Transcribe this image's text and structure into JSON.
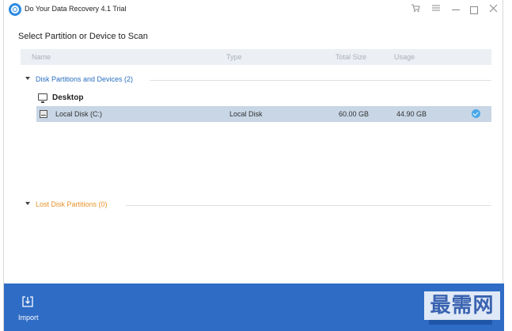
{
  "window": {
    "title": "Do Your Data Recovery 4.1 Trial"
  },
  "main": {
    "heading": "Select Partition or Device to Scan",
    "columns": {
      "name": "Name",
      "type": "Type",
      "total_size": "Total Size",
      "usage": "Usage"
    },
    "groups": [
      {
        "label": "Disk Partitions and Devices (2)",
        "devices": [
          {
            "label": "Desktop",
            "disks": [
              {
                "name": "Local Disk (C:)",
                "type": "Local Disk",
                "total_size": "60.00 GB",
                "usage": "44.90 GB",
                "selected": true
              }
            ]
          }
        ]
      },
      {
        "label": "Lost Disk Partitions (0)"
      }
    ]
  },
  "bottom": {
    "import_label": "Import",
    "watermark": "最需网"
  },
  "colors": {
    "accent": "#2f6cc6",
    "selected_row": "#c8d6e5",
    "lost_group": "#e8922b"
  }
}
